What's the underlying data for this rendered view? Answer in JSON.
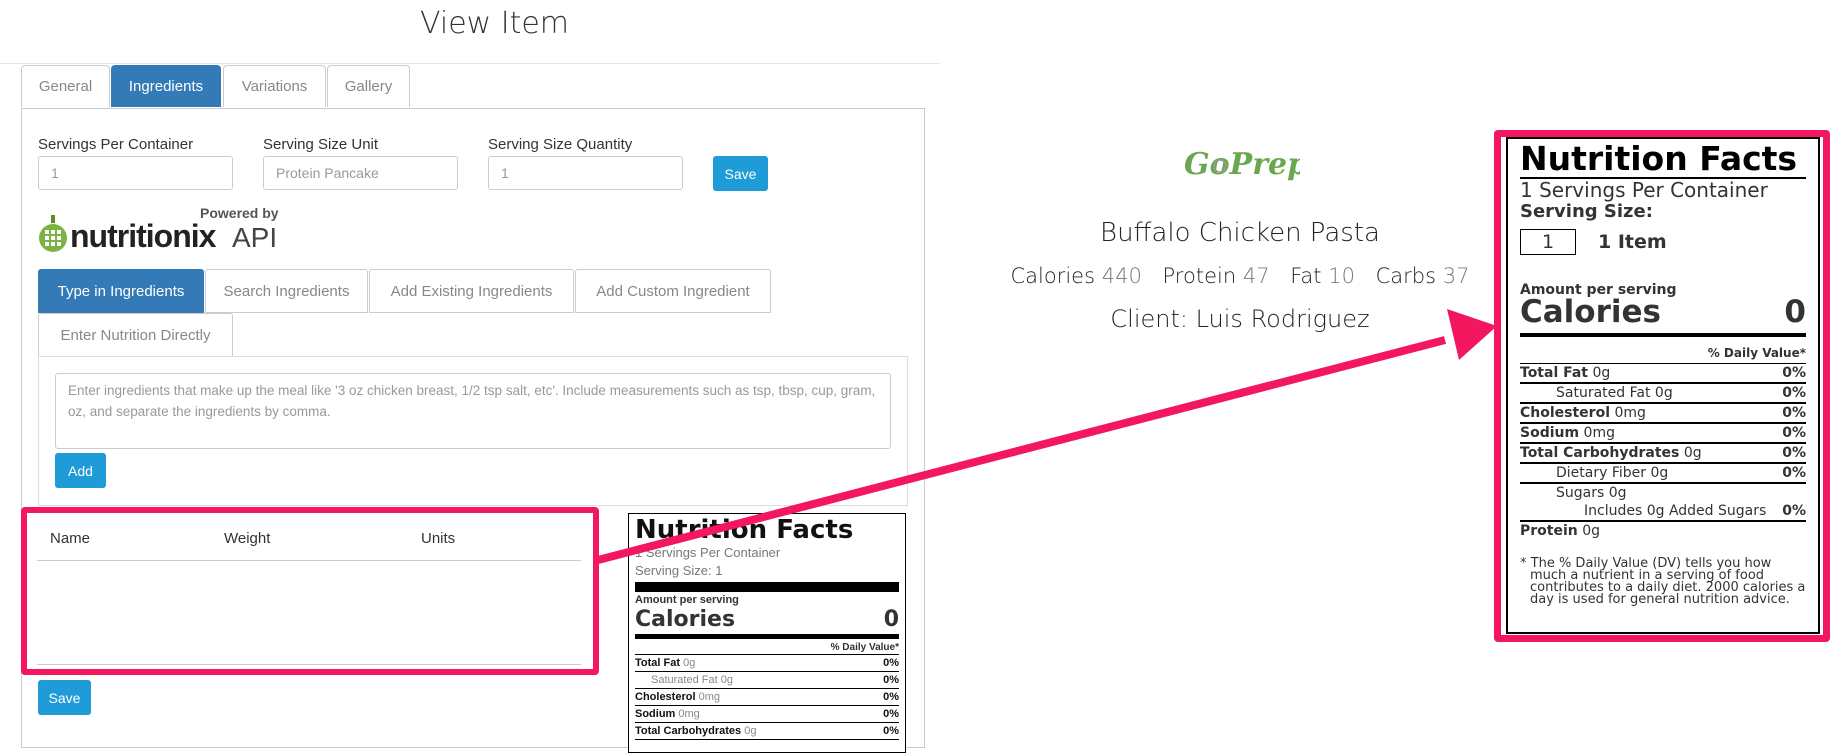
{
  "page": {
    "title": "View Item"
  },
  "tabs": [
    {
      "label": "General",
      "active": false
    },
    {
      "label": "Ingredients",
      "active": true
    },
    {
      "label": "Variations",
      "active": false
    },
    {
      "label": "Gallery",
      "active": false
    }
  ],
  "serving_form": {
    "servings_per_container_label": "Servings Per Container",
    "servings_per_container_placeholder": "1",
    "serving_size_unit_label": "Serving Size Unit",
    "serving_size_unit_placeholder": "Protein Pancake",
    "serving_size_quantity_label": "Serving Size Quantity",
    "serving_size_quantity_placeholder": "1",
    "save_label": "Save"
  },
  "nutritionix": {
    "powered_by": "Powered by",
    "brand": "nutritionix",
    "api": "API"
  },
  "ingredient_tabs": [
    {
      "label": "Type in Ingredients",
      "active": true
    },
    {
      "label": "Search Ingredients",
      "active": false
    },
    {
      "label": "Add Existing Ingredients",
      "active": false
    },
    {
      "label": "Add Custom Ingredient",
      "active": false
    },
    {
      "label": "Enter Nutrition Directly",
      "active": false
    }
  ],
  "ingredient_entry": {
    "placeholder": "Enter ingredients that make up the meal like '3 oz chicken breast, 1/2 tsp salt, etc'. Include measurements such as tsp, tbsp, cup, gram, oz, and separate the ingredients by comma.",
    "add_label": "Add"
  },
  "ingredients_table": {
    "columns": [
      "Name",
      "Weight",
      "Units"
    ],
    "rows": [],
    "save_label": "Save"
  },
  "nutrition_label_small": {
    "title": "Nutrition Facts",
    "servings_line": "1 Servings Per Container",
    "serving_size_line": "Serving Size: 1",
    "amount_per_serving": "Amount per serving",
    "calories_label": "Calories",
    "calories_value": "0",
    "daily_value_header": "% Daily Value*",
    "rows": [
      {
        "name": "Total Fat",
        "amount": "0g",
        "pct": "0%",
        "bold": true,
        "indent": false
      },
      {
        "name": "Saturated Fat",
        "amount": "0g",
        "pct": "0%",
        "bold": false,
        "indent": true
      },
      {
        "name": "Cholesterol",
        "amount": "0mg",
        "pct": "0%",
        "bold": true,
        "indent": false
      },
      {
        "name": "Sodium",
        "amount": "0mg",
        "pct": "0%",
        "bold": true,
        "indent": false
      },
      {
        "name": "Total Carbohydrates",
        "amount": "0g",
        "pct": "0%",
        "bold": true,
        "indent": false
      }
    ]
  },
  "meal_preview": {
    "logo_text": "GoPrep",
    "meal_name": "Buffalo Chicken Pasta",
    "macros": [
      {
        "label": "Calories",
        "value": "440"
      },
      {
        "label": "Protein",
        "value": "47"
      },
      {
        "label": "Fat",
        "value": "10"
      },
      {
        "label": "Carbs",
        "value": "37"
      }
    ],
    "client": "Client: Luis Rodriguez"
  },
  "nutrition_label_large": {
    "title": "Nutrition Facts",
    "servings_line": "1 Servings Per Container",
    "serving_size_label": "Serving Size:",
    "serving_size_qty": "1",
    "serving_size_unit": "1 Item",
    "amount_per_serving": "Amount per serving",
    "calories_label": "Calories",
    "calories_value": "0",
    "daily_value_header": "% Daily Value*",
    "rows": [
      {
        "name": "Total Fat",
        "amount": "0g",
        "pct": "0%"
      },
      {
        "name": "Saturated Fat",
        "amount": "0g",
        "pct": "0%"
      },
      {
        "name": "Cholesterol",
        "amount": "0mg",
        "pct": "0%"
      },
      {
        "name": "Sodium",
        "amount": "0mg",
        "pct": "0%"
      },
      {
        "name": "Total Carbohydrates",
        "amount": "0g",
        "pct": "0%"
      },
      {
        "name": "Dietary Fiber",
        "amount": "0g",
        "pct": "0%"
      },
      {
        "name": "Sugars",
        "amount": "0g",
        "pct": ""
      },
      {
        "name": "Includes 0g Added Sugars",
        "amount": "",
        "pct": "0%"
      },
      {
        "name": "Protein",
        "amount": "0g",
        "pct": ""
      }
    ],
    "footnote": "* The % Daily Value (DV) tells you how much a nutrient in a serving of food contributes to a daily diet. 2000 calories a day is used for general nutrition advice."
  },
  "colors": {
    "primary": "#337ab7",
    "button": "#1f9bd7",
    "highlight": "#f2175f"
  }
}
